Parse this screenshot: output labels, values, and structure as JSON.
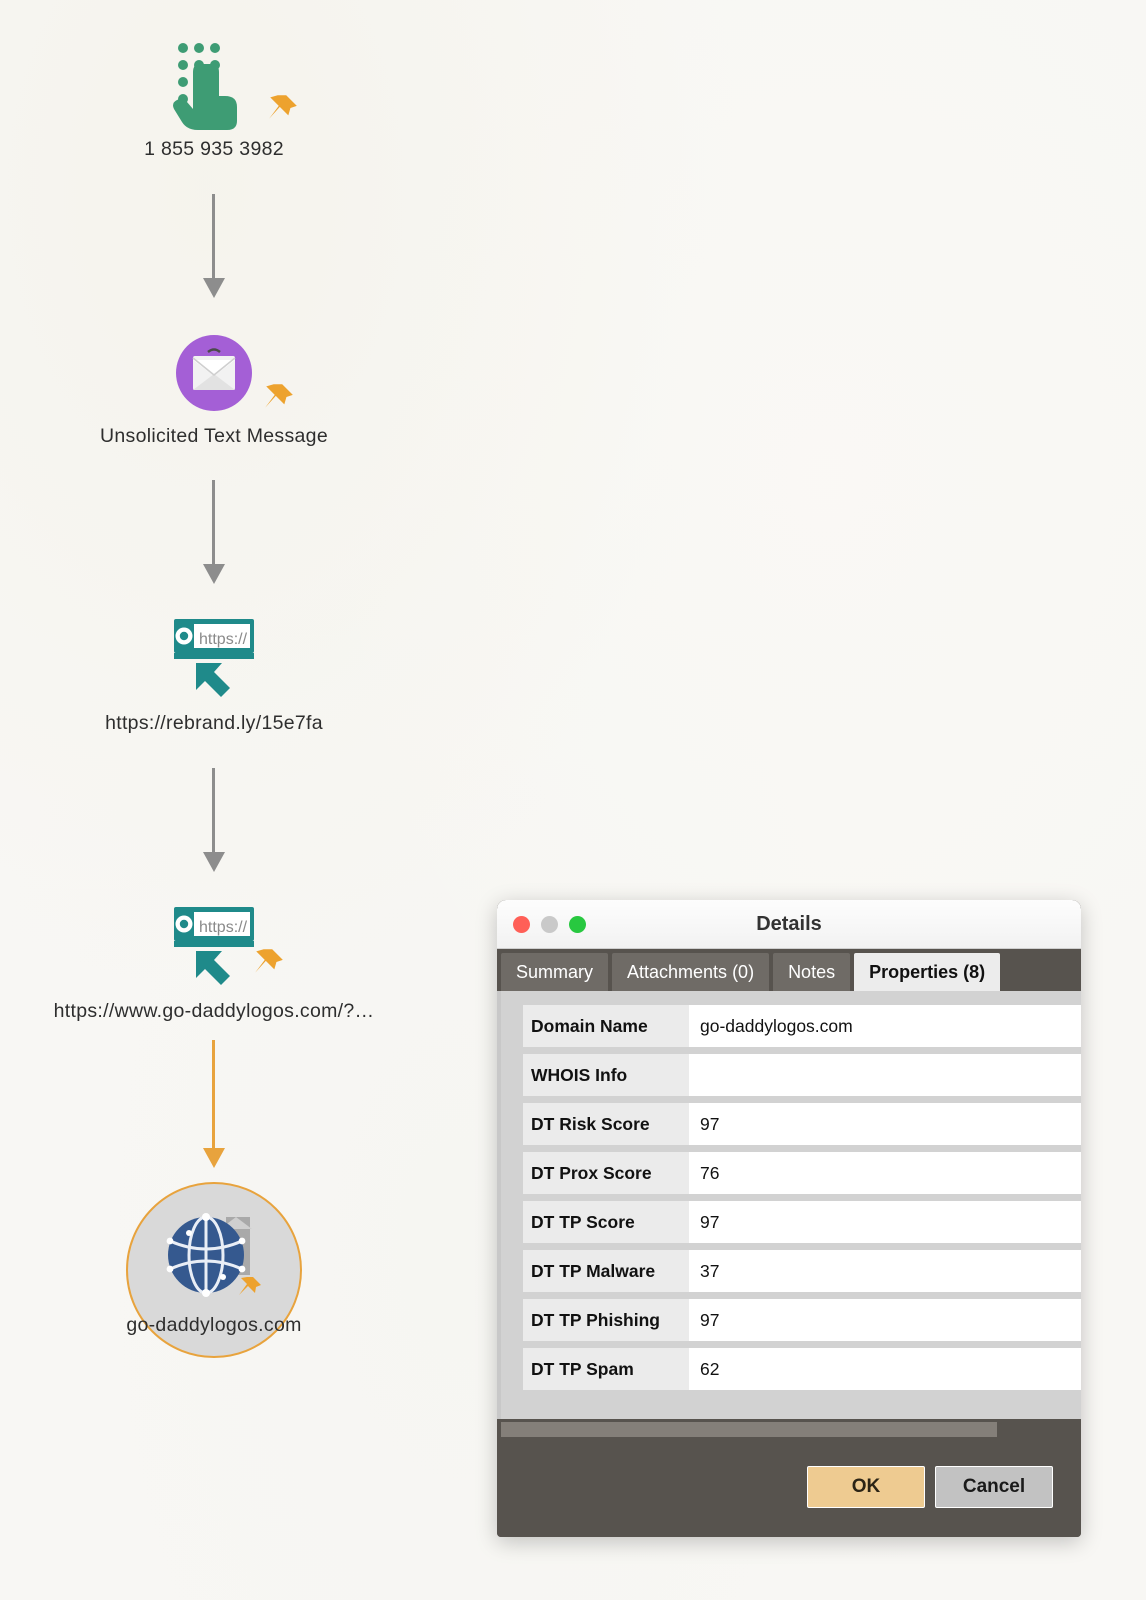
{
  "graph": {
    "nodes": [
      {
        "id": "phone",
        "label": "1 855 935 3982",
        "icon": "phone-dial-icon",
        "pinned": true,
        "selected": false
      },
      {
        "id": "message",
        "label": "Unsolicited Text Message",
        "icon": "text-message-icon",
        "pinned": true,
        "selected": false
      },
      {
        "id": "url1",
        "label": "https://rebrand.ly/15e7fa",
        "icon": "url-icon",
        "pinned": false,
        "selected": false
      },
      {
        "id": "url2",
        "label": "https://www.go-daddylogos.com/?…",
        "icon": "url-icon",
        "pinned": true,
        "selected": false
      },
      {
        "id": "domain",
        "label": "go-daddylogos.com",
        "icon": "domain-globe-icon",
        "pinned": true,
        "selected": true
      }
    ],
    "edge_color_default": "#8d8d8d",
    "edge_color_selected": "#e8a33d",
    "selection_ring_color": "#e8a33d"
  },
  "dialog": {
    "title": "Details",
    "window_controls": {
      "close": "close-button",
      "minimize": "minimize-button",
      "zoom": "zoom-button"
    },
    "tabs": [
      {
        "label": "Summary",
        "active": false
      },
      {
        "label": "Attachments (0)",
        "active": false
      },
      {
        "label": "Notes",
        "active": false
      },
      {
        "label": "Properties (8)",
        "active": true
      }
    ],
    "properties": [
      {
        "key": "Domain Name",
        "value": "go-daddylogos.com"
      },
      {
        "key": "WHOIS Info",
        "value": ""
      },
      {
        "key": "DT Risk Score",
        "value": "97"
      },
      {
        "key": "DT Prox Score",
        "value": "76"
      },
      {
        "key": "DT TP Score",
        "value": "97"
      },
      {
        "key": "DT TP Malware",
        "value": "37"
      },
      {
        "key": "DT TP Phishing",
        "value": "97"
      },
      {
        "key": "DT TP Spam",
        "value": "62"
      }
    ],
    "buttons": {
      "ok": "OK",
      "cancel": "Cancel"
    },
    "colors": {
      "chrome": "#57534e",
      "tab_inactive": "#6f6b66",
      "tab_active": "#ececec",
      "ok_button": "#eecb91",
      "cancel_button": "#c2c2c2"
    }
  }
}
